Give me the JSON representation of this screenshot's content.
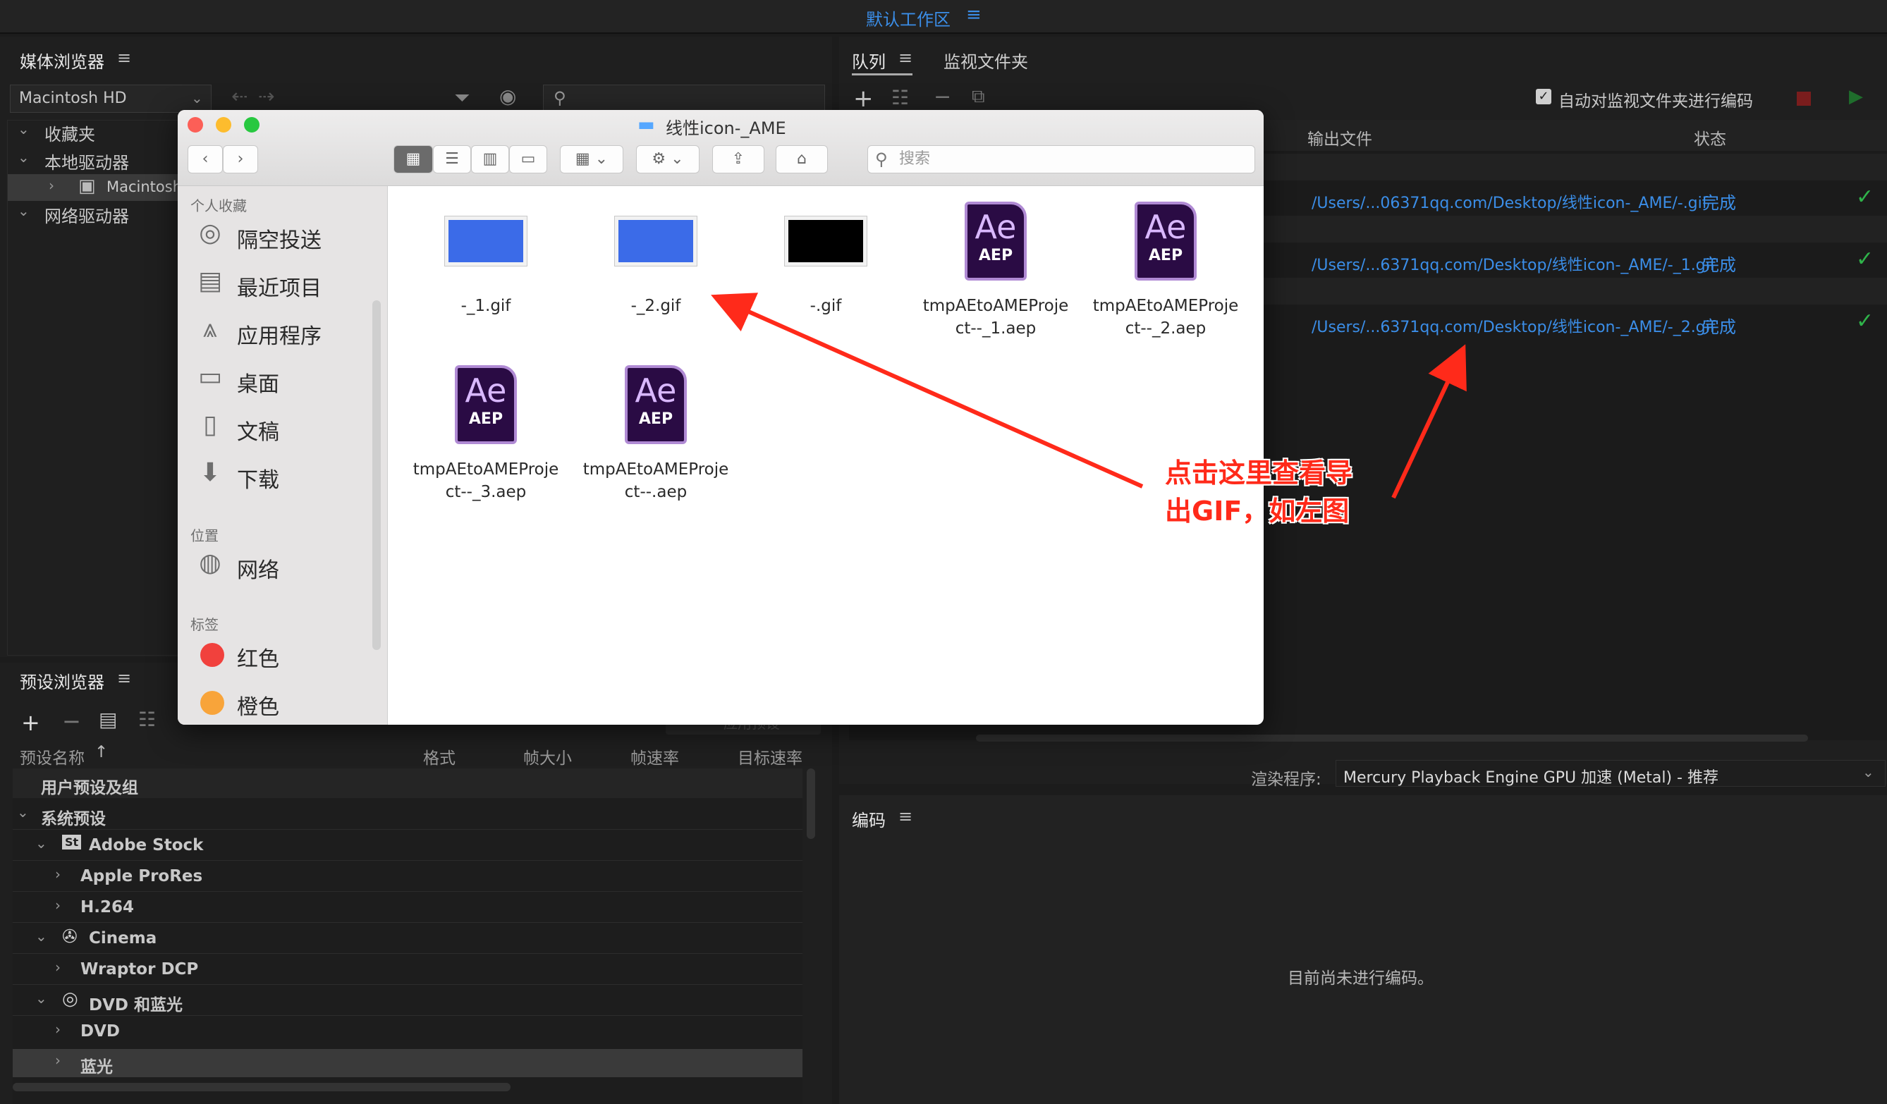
{
  "topbar": {
    "workspace": "默认工作区",
    "menu": "≡"
  },
  "media_browser": {
    "title": "媒体浏览器",
    "menu": "≡",
    "drive": "Macintosh HD",
    "tree": [
      {
        "label": "收藏夹"
      },
      {
        "label": "本地驱动器"
      },
      {
        "label": "Macintosh"
      },
      {
        "label": "网络驱动器"
      }
    ]
  },
  "preset_browser": {
    "title": "预设浏览器",
    "menu": "≡",
    "apply_button": "应用预设",
    "columns": [
      "预设名称",
      "格式",
      "帧大小",
      "帧速率",
      "目标速率"
    ],
    "rows": [
      "用户预设及组",
      "系统预设",
      "Adobe Stock",
      "Apple ProRes",
      "H.264",
      "Cinema",
      "Wraptor DCP",
      "DVD 和蓝光",
      "DVD",
      "蓝光"
    ]
  },
  "queue": {
    "tab_queue": "队列",
    "tab_watch": "监视文件夹",
    "menu": "≡",
    "auto_encode": "自动对监视文件夹进行编码",
    "col_output": "输出文件",
    "col_status": "状态",
    "items": [
      {
        "output": "/Users/...06371qq.com/Desktop/线性icon-_AME/-.gif",
        "status": "完成"
      },
      {
        "output": "/Users/...6371qq.com/Desktop/线性icon-_AME/-_1.gif",
        "status": "完成"
      },
      {
        "output": "/Users/...6371qq.com/Desktop/线性icon-_AME/-_2.gif",
        "status": "完成"
      }
    ],
    "renderer_label": "渲染程序:",
    "renderer_value": "Mercury Playback Engine GPU 加速 (Metal) - 推荐"
  },
  "encoding": {
    "title": "编码",
    "menu": "≡",
    "empty": "目前尚未进行编码。"
  },
  "finder": {
    "title": "线性icon-_AME",
    "search_placeholder": "搜索",
    "sections": {
      "favorites": "个人收藏",
      "locations": "位置",
      "tags": "标签"
    },
    "favorites": [
      "隔空投送",
      "最近项目",
      "应用程序",
      "桌面",
      "文稿",
      "下载"
    ],
    "locations": [
      "网络"
    ],
    "tags": [
      {
        "label": "红色",
        "color": "#f1413d"
      },
      {
        "label": "橙色",
        "color": "#f8a43a"
      }
    ],
    "files": [
      {
        "name": "-_1.gif",
        "kind": "gif",
        "icon": "gif-blue"
      },
      {
        "name": "-_2.gif",
        "kind": "gif",
        "icon": "gif-blue"
      },
      {
        "name": "-.gif",
        "kind": "gif",
        "icon": "gif-black"
      },
      {
        "name_line1": "tmpAEtoAMEProje",
        "name_line2": "ct--_1.aep",
        "kind": "aep"
      },
      {
        "name_line1": "tmpAEtoAMEProje",
        "name_line2": "ct--_2.aep",
        "kind": "aep"
      },
      {
        "name_line1": "tmpAEtoAMEProje",
        "name_line2": "ct--_3.aep",
        "kind": "aep"
      },
      {
        "name_line1": "tmpAEtoAMEProje",
        "name_line2": "ct--.aep",
        "kind": "aep"
      }
    ],
    "ae_label": "Ae",
    "aep_label": "AEP"
  },
  "annotation": {
    "line1": "点击这里查看导",
    "line2": "出GIF，如左图",
    "color": "#ff2a1a"
  }
}
